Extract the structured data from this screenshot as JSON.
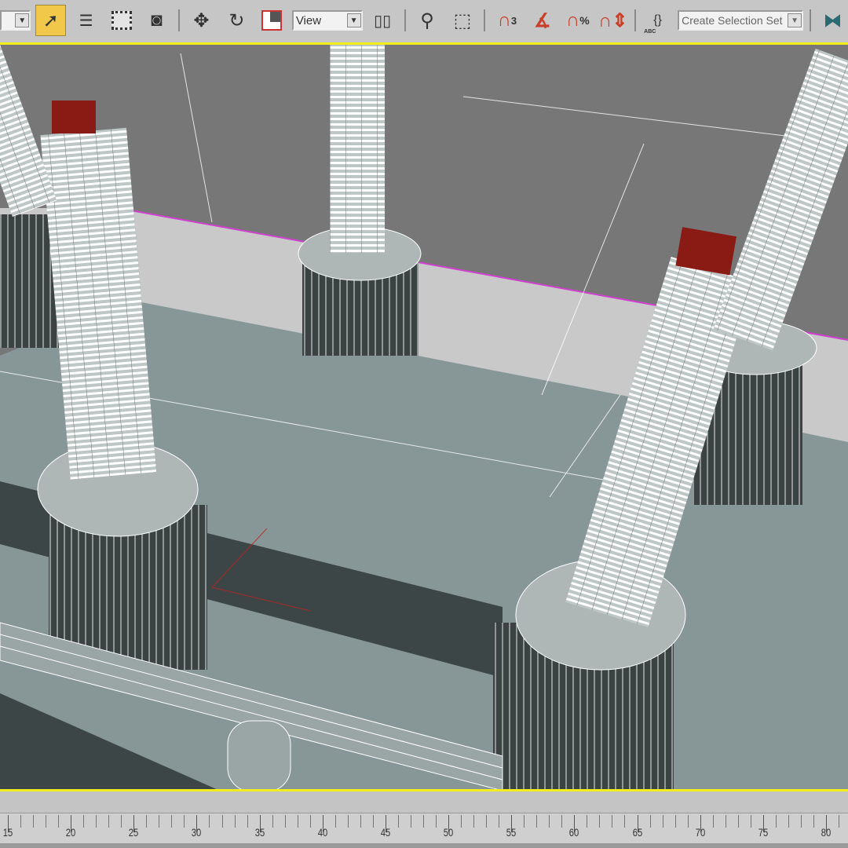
{
  "toolbar": {
    "items": [
      {
        "name": "select-object",
        "icon": "arrow-cursor-icon",
        "active": true
      },
      {
        "name": "select-by-name",
        "icon": "list-cursor-icon"
      },
      {
        "name": "rectangular-selection",
        "icon": "dotted-rect-icon"
      },
      {
        "name": "window-crossing",
        "icon": "crossing-icon"
      },
      {
        "name": "select-and-move",
        "icon": "move-icon"
      },
      {
        "name": "select-and-rotate",
        "icon": "rotate-icon"
      },
      {
        "name": "select-and-scale",
        "icon": "scale-icon"
      }
    ],
    "reference_coord": "View",
    "snap_3d_label": "3",
    "percent_snap_label": "%",
    "named_selection_placeholder": "Create Selection Set",
    "abc_label": "ABC"
  },
  "timeline": {
    "labels": [
      "15",
      "20",
      "25",
      "30",
      "35",
      "40",
      "45",
      "50",
      "55",
      "60",
      "65",
      "70",
      "75",
      "80"
    ],
    "start": 15,
    "end": 80
  },
  "colors": {
    "active_tool": "#f1c84a",
    "viewport_border": "#f2ee1a",
    "wireframe": "#ffffff",
    "cap_red": "#8a1a14"
  }
}
